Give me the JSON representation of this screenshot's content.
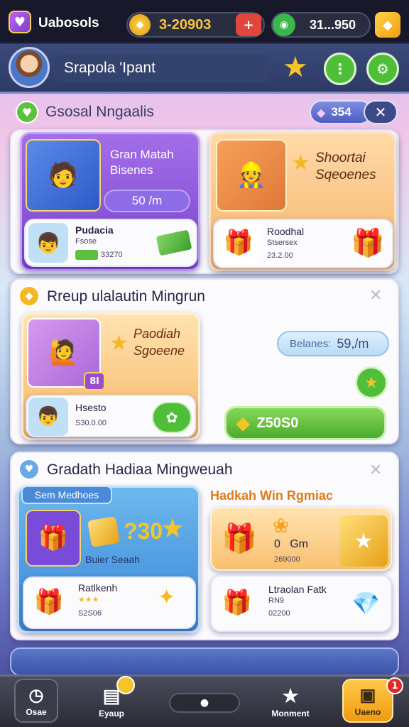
{
  "topbar": {
    "app_name": "Uabosols",
    "currency1": "3-20903",
    "currency2": "31...950"
  },
  "header": {
    "title": "Srapola 'Ipant"
  },
  "section1": {
    "title": "Gsosal Nngaalis",
    "badge": "354"
  },
  "card_a": {
    "title_line1": "Gran Matah",
    "title_line2": "Bisenes",
    "price": "50 /m",
    "item_title": "Pudacia",
    "item_sub": "Fsose",
    "item_price": "33270"
  },
  "card_b": {
    "title_line1": "Shoortai",
    "title_line2": "Sqeoenes",
    "item_title": "Roodhal",
    "item_sub": "Stsersex",
    "item_price": "23.2.00"
  },
  "section2": {
    "title": "Rreup ulalautin Mingrun",
    "promo_line1": "Paodiah",
    "promo_line2": "Sgoeene",
    "badge_num": "8l",
    "item_title": "Hsesto",
    "item_price": "S30.0.00",
    "balance_label": "Belanes:",
    "balance_value": "59,/m",
    "buy_label": "Z50S0"
  },
  "section3": {
    "title": "Gradath Hadiaa Mingweuah",
    "tag": "Sem Medhoes",
    "right_title": "Hadkah Win Rgmiac",
    "left_price": "?30",
    "left_caption": "Buier Seaah",
    "item_title": "Ratlkenh",
    "item_price": "S2S06",
    "right_big": "0   Gm",
    "right_small": "269000",
    "right_item_title": "Ltraolan Fatk",
    "right_item_sub": "RN9",
    "right_item_price": "02200"
  },
  "nav": {
    "item1": "Osae",
    "item2": "Eyaup",
    "item4": "Monment",
    "item5": "Uaeno",
    "notif": "1"
  },
  "colors": {
    "purple": "#8b54d6",
    "orange": "#f6b35a",
    "green": "#5cc23e",
    "gold": "#f5b723"
  }
}
